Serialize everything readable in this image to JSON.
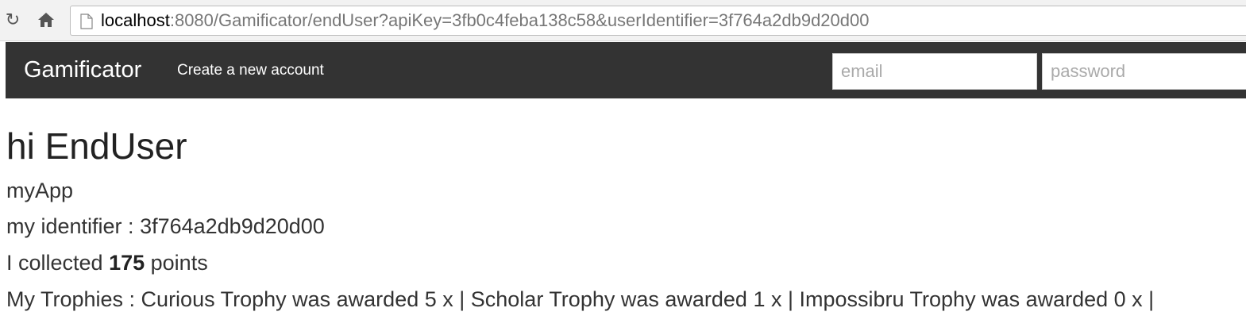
{
  "browser": {
    "url_host": "localhost",
    "url_rest": ":8080/Gamificator/endUser?apiKey=3fb0c4feba138c58&userIdentifier=3f764a2db9d20d00",
    "reload_icon": "reload-icon",
    "home_icon": "home-icon",
    "page_icon": "page-icon"
  },
  "navbar": {
    "brand": "Gamificator",
    "create_account": "Create a new account",
    "email_placeholder": "email",
    "password_placeholder": "password",
    "background": "#333333"
  },
  "main": {
    "greeting": "hi EndUser",
    "app_name": "myApp",
    "identifier_label": "my identifier : ",
    "identifier_value": "3f764a2db9d20d00",
    "points_prefix": "I collected ",
    "points_value": "175",
    "points_suffix": " points",
    "trophies_text": "My Trophies : Curious Trophy was awarded 5 x | Scholar Trophy was awarded 1 x | Impossibru Trophy was awarded 0 x |"
  }
}
